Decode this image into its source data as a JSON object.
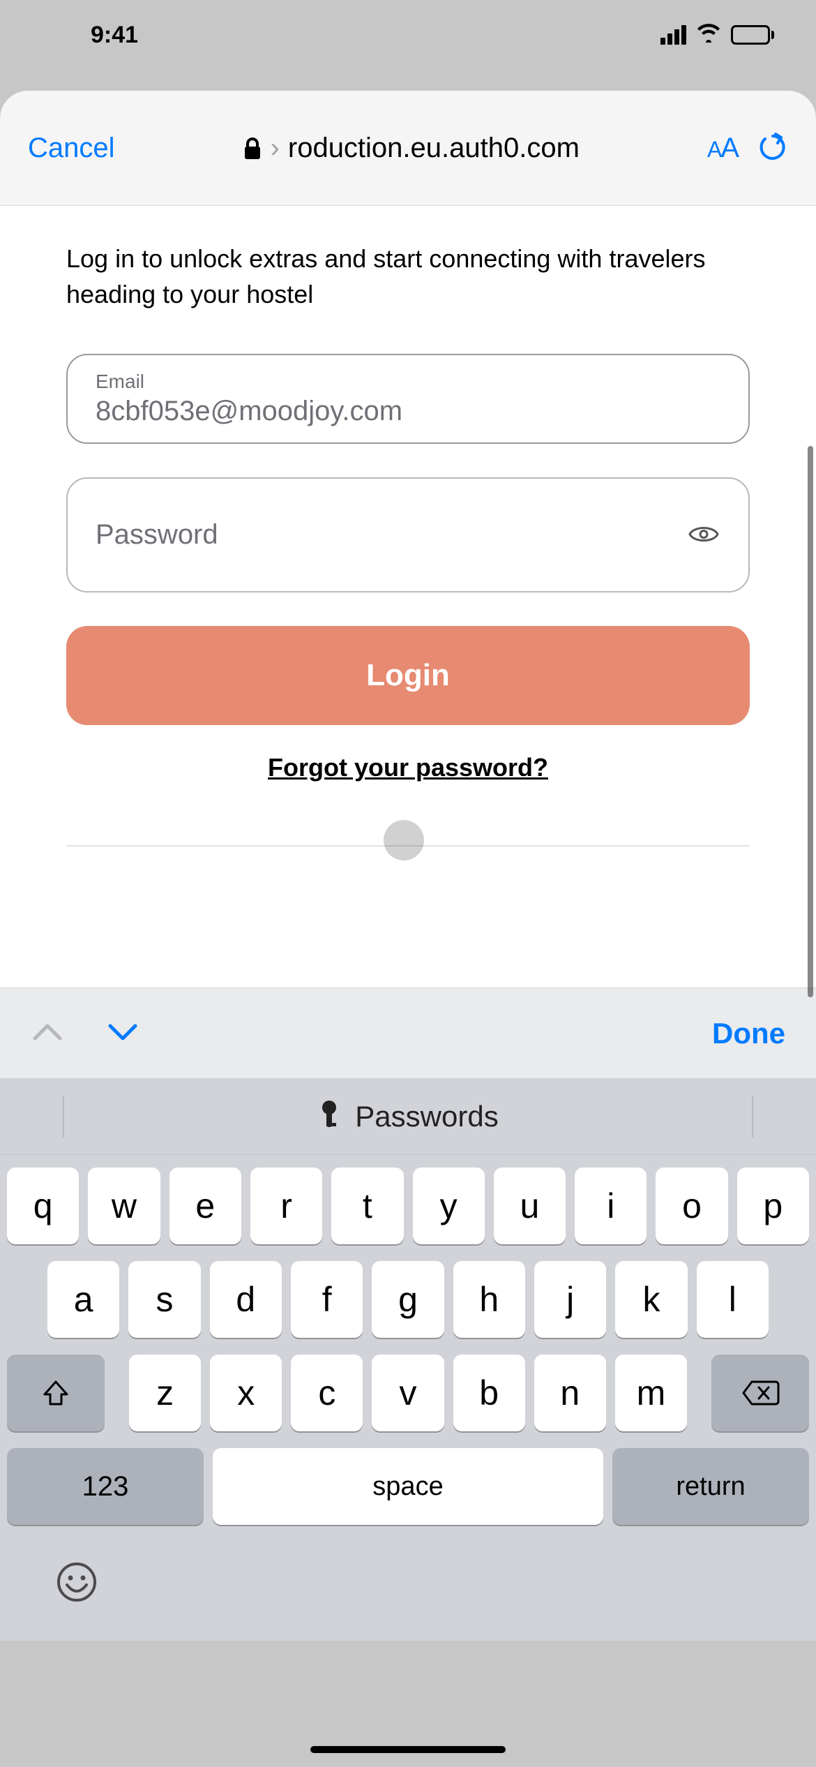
{
  "status": {
    "time": "9:41"
  },
  "browser": {
    "cancel_label": "Cancel",
    "url_truncated_prefix": "›",
    "url_display": "roduction.eu.auth0.com",
    "aa_small": "A",
    "aa_big": "A"
  },
  "login": {
    "subtitle": "Log in to unlock extras and start connecting with travelers heading to your hostel",
    "email_label": "Email",
    "email_value": "8cbf053e@moodjoy.com",
    "password_placeholder": "Password",
    "login_button": "Login",
    "forgot_label": "Forgot your password?"
  },
  "keyboard": {
    "done_label": "Done",
    "suggestion_label": "Passwords",
    "row1": [
      "q",
      "w",
      "e",
      "r",
      "t",
      "y",
      "u",
      "i",
      "o",
      "p"
    ],
    "row2": [
      "a",
      "s",
      "d",
      "f",
      "g",
      "h",
      "j",
      "k",
      "l"
    ],
    "row3": [
      "z",
      "x",
      "c",
      "v",
      "b",
      "n",
      "m"
    ],
    "numbers_label": "123",
    "space_label": "space",
    "return_label": "return"
  }
}
